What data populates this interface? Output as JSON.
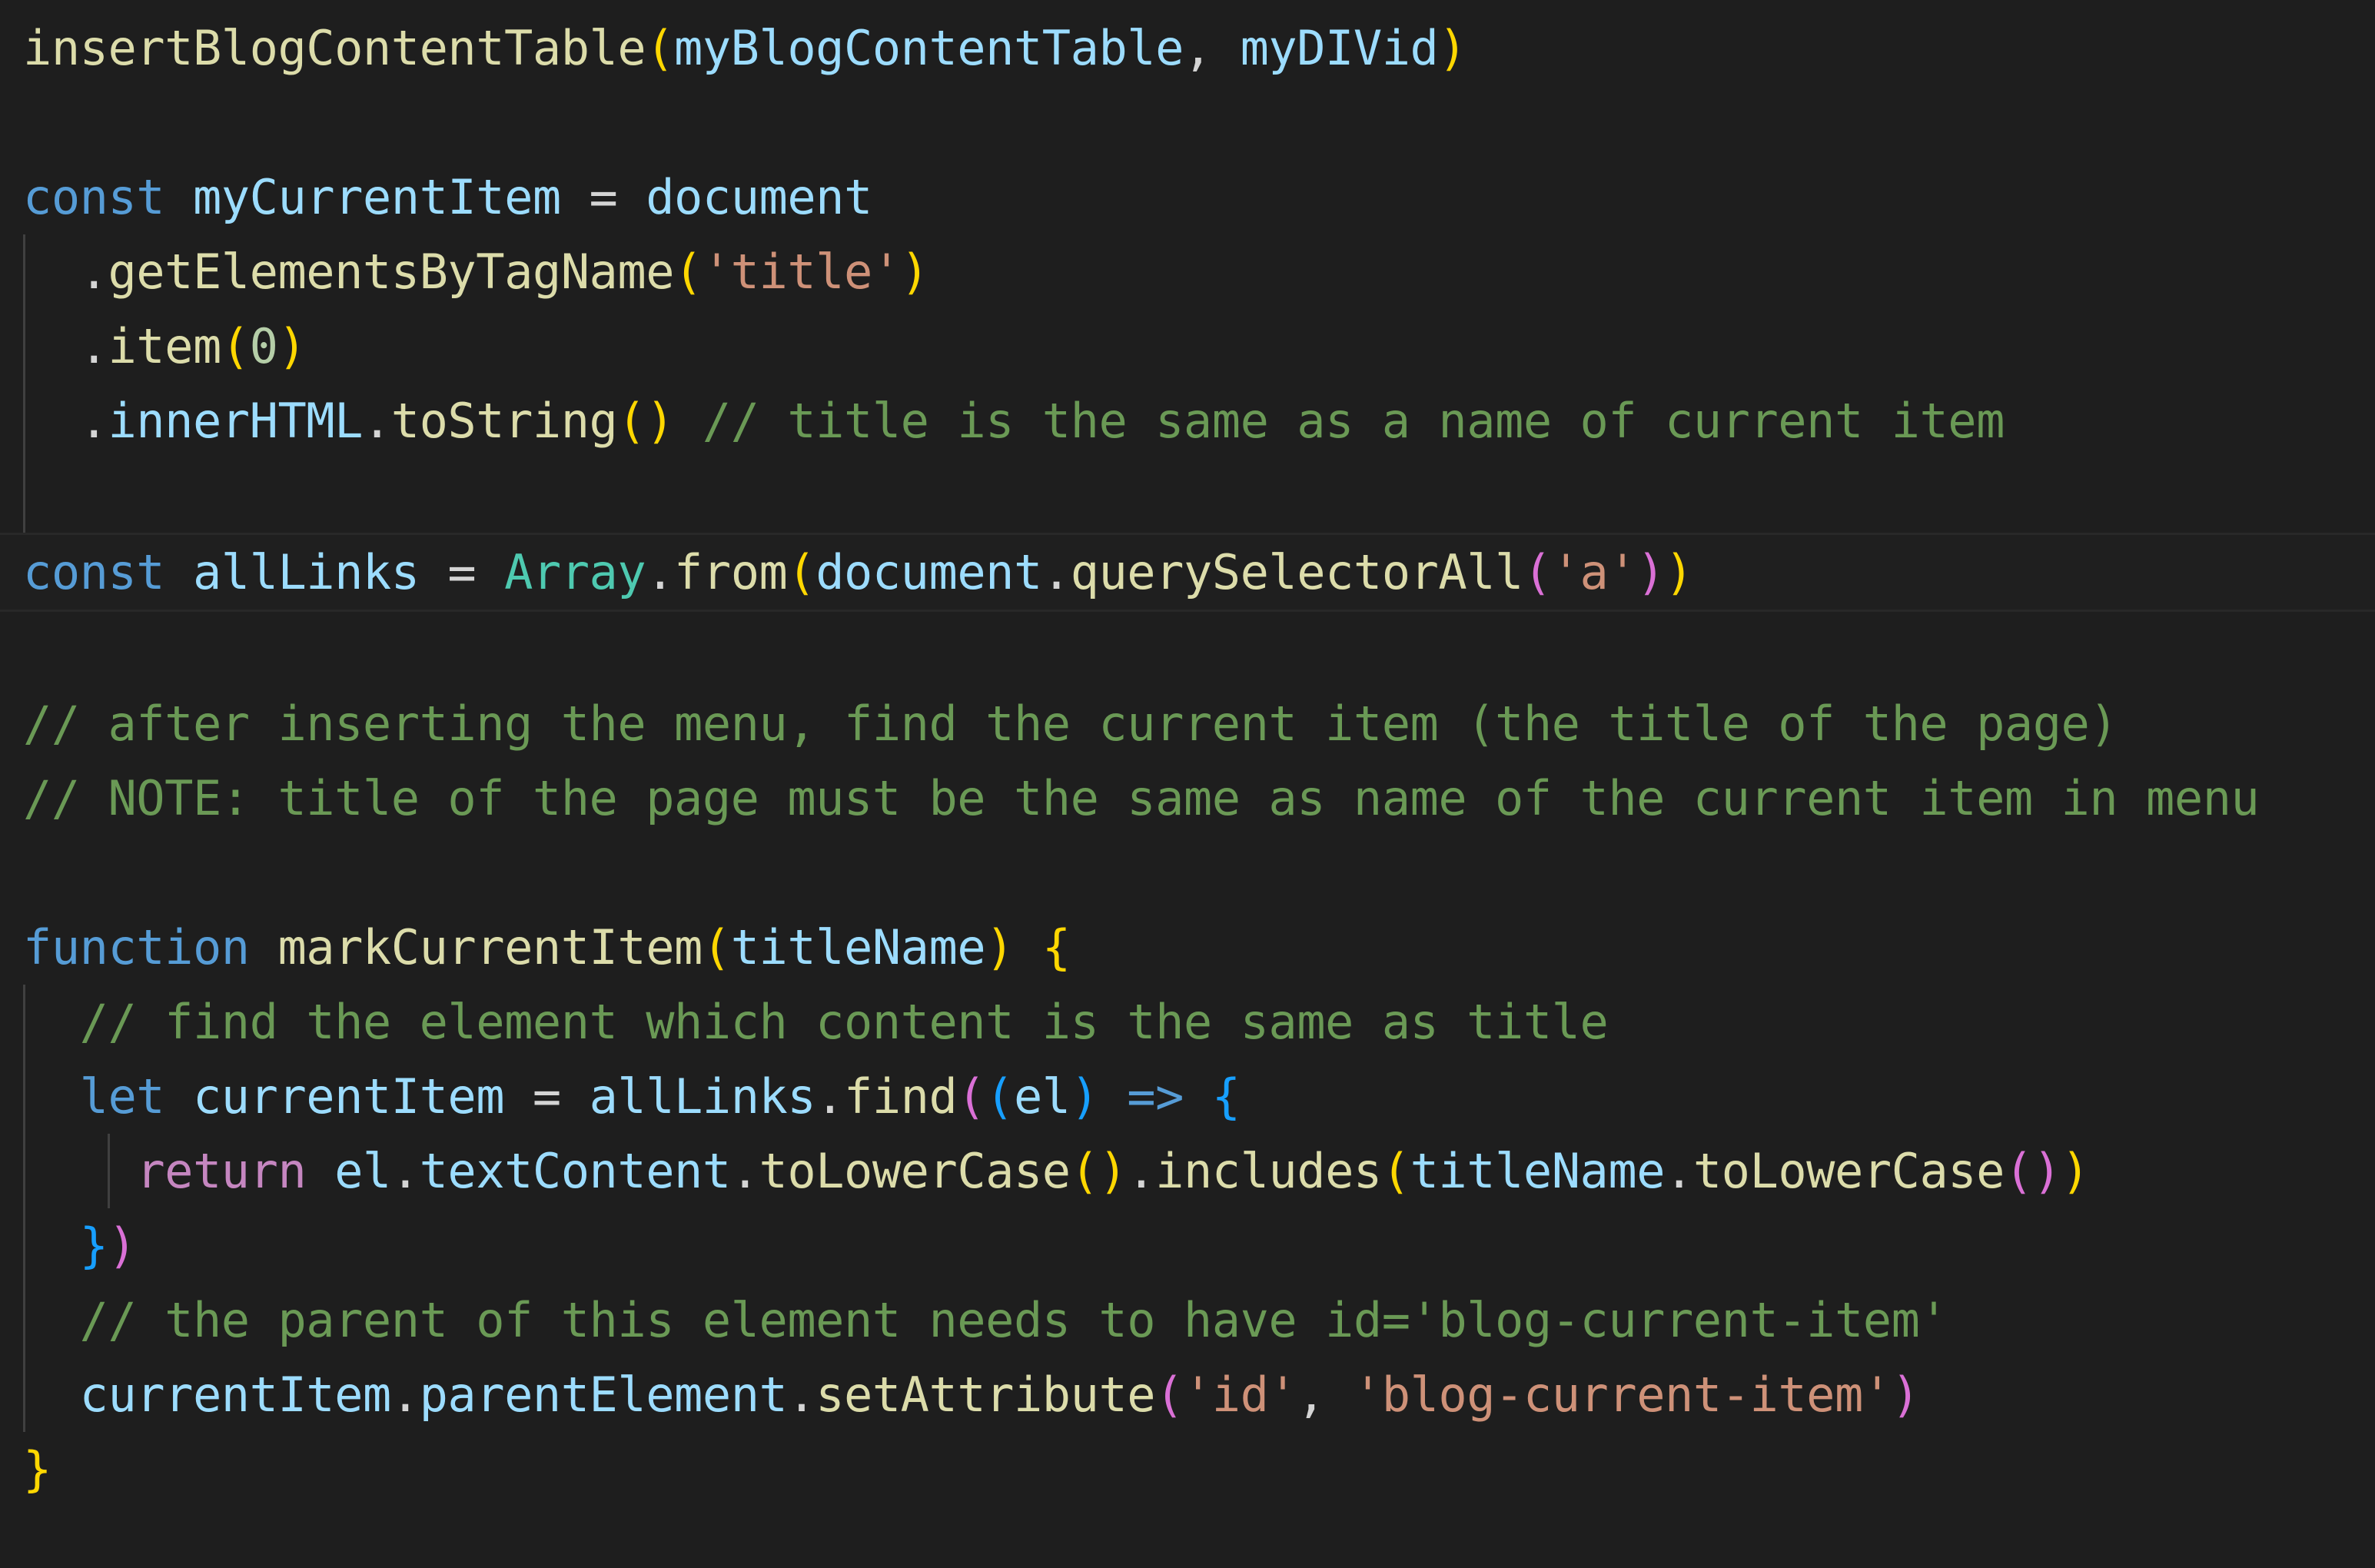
{
  "editor": {
    "theme_name": "dark-plus",
    "language": "javascript",
    "background_color": "#1e1e1e",
    "current_line_background": "#1f1f1f",
    "current_line_border_color": "#282828",
    "indent_guide_color": "#404040",
    "colors": {
      "function": "#dcdcaa",
      "variable": "#9cdcfe",
      "keyword": "#569cd6",
      "control_keyword": "#c586c0",
      "string": "#ce9178",
      "number": "#b5cea8",
      "comment": "#6a9955",
      "class": "#4ec9b0",
      "plain": "#d4d4d4",
      "bracket_level_1": "#ffd700",
      "bracket_level_2": "#da70d6",
      "bracket_level_3": "#179fff"
    },
    "lines": [
      {
        "index": 1,
        "current": false,
        "indent_guides": 0,
        "text": "insertBlogContentTable(myBlogContentTable, myDIVid)",
        "tokens": [
          {
            "t": "insertBlogContentTable",
            "c": "t-fn"
          },
          {
            "t": "(",
            "c": "t-b1"
          },
          {
            "t": "myBlogContentTable",
            "c": "t-var"
          },
          {
            "t": ", ",
            "c": "t-plain"
          },
          {
            "t": "myDIVid",
            "c": "t-var"
          },
          {
            "t": ")",
            "c": "t-b1"
          }
        ]
      },
      {
        "index": 2,
        "current": false,
        "indent_guides": 0,
        "text": "",
        "tokens": []
      },
      {
        "index": 3,
        "current": false,
        "indent_guides": 0,
        "text": "const myCurrentItem = document",
        "tokens": [
          {
            "t": "const",
            "c": "t-kw"
          },
          {
            "t": " ",
            "c": "t-plain"
          },
          {
            "t": "myCurrentItem",
            "c": "t-var"
          },
          {
            "t": " = ",
            "c": "t-op"
          },
          {
            "t": "document",
            "c": "t-var"
          }
        ]
      },
      {
        "index": 4,
        "current": false,
        "indent_guides": 1,
        "text": "  .getElementsByTagName('title')",
        "tokens": [
          {
            "t": "  .",
            "c": "t-plain"
          },
          {
            "t": "getElementsByTagName",
            "c": "t-fn"
          },
          {
            "t": "(",
            "c": "t-b1"
          },
          {
            "t": "'title'",
            "c": "t-str"
          },
          {
            "t": ")",
            "c": "t-b1"
          }
        ]
      },
      {
        "index": 5,
        "current": false,
        "indent_guides": 1,
        "text": "  .item(0)",
        "tokens": [
          {
            "t": "  .",
            "c": "t-plain"
          },
          {
            "t": "item",
            "c": "t-fn"
          },
          {
            "t": "(",
            "c": "t-b1"
          },
          {
            "t": "0",
            "c": "t-num"
          },
          {
            "t": ")",
            "c": "t-b1"
          }
        ]
      },
      {
        "index": 6,
        "current": false,
        "indent_guides": 1,
        "text": "  .innerHTML.toString() // title is the same as a name of current item",
        "tokens": [
          {
            "t": "  .",
            "c": "t-plain"
          },
          {
            "t": "innerHTML",
            "c": "t-var"
          },
          {
            "t": ".",
            "c": "t-plain"
          },
          {
            "t": "toString",
            "c": "t-fn"
          },
          {
            "t": "(",
            "c": "t-b1"
          },
          {
            "t": ")",
            "c": "t-b1"
          },
          {
            "t": " ",
            "c": "t-plain"
          },
          {
            "t": "// title is the same as a name of current item",
            "c": "t-comment"
          }
        ]
      },
      {
        "index": 7,
        "current": false,
        "indent_guides": 1,
        "text": "",
        "tokens": []
      },
      {
        "index": 8,
        "current": true,
        "indent_guides": 0,
        "text": "const allLinks = Array.from(document.querySelectorAll('a'))",
        "tokens": [
          {
            "t": "const",
            "c": "t-kw"
          },
          {
            "t": " ",
            "c": "t-plain"
          },
          {
            "t": "allLinks",
            "c": "t-var"
          },
          {
            "t": " = ",
            "c": "t-op"
          },
          {
            "t": "Array",
            "c": "t-class"
          },
          {
            "t": ".",
            "c": "t-plain"
          },
          {
            "t": "from",
            "c": "t-fn"
          },
          {
            "t": "(",
            "c": "t-b1"
          },
          {
            "t": "document",
            "c": "t-var"
          },
          {
            "t": ".",
            "c": "t-plain"
          },
          {
            "t": "querySelectorAll",
            "c": "t-fn"
          },
          {
            "t": "(",
            "c": "t-b2"
          },
          {
            "t": "'a'",
            "c": "t-str"
          },
          {
            "t": ")",
            "c": "t-b2"
          },
          {
            "t": ")",
            "c": "t-b1"
          }
        ]
      },
      {
        "index": 9,
        "current": false,
        "indent_guides": 0,
        "text": "",
        "tokens": []
      },
      {
        "index": 10,
        "current": false,
        "indent_guides": 0,
        "text": "// after inserting the menu, find the current item (the title of the page)",
        "tokens": [
          {
            "t": "// after inserting the menu, find the current item (the title of the page)",
            "c": "t-comment"
          }
        ]
      },
      {
        "index": 11,
        "current": false,
        "indent_guides": 0,
        "text": "// NOTE: title of the page must be the same as name of the current item in menu",
        "tokens": [
          {
            "t": "// NOTE: title of the page must be the same as name of the current item in menu",
            "c": "t-comment"
          }
        ]
      },
      {
        "index": 12,
        "current": false,
        "indent_guides": 0,
        "text": "",
        "tokens": []
      },
      {
        "index": 13,
        "current": false,
        "indent_guides": 0,
        "text": "function markCurrentItem(titleName) {",
        "tokens": [
          {
            "t": "function",
            "c": "t-kw"
          },
          {
            "t": " ",
            "c": "t-plain"
          },
          {
            "t": "markCurrentItem",
            "c": "t-fn"
          },
          {
            "t": "(",
            "c": "t-b1"
          },
          {
            "t": "titleName",
            "c": "t-var"
          },
          {
            "t": ")",
            "c": "t-b1"
          },
          {
            "t": " ",
            "c": "t-plain"
          },
          {
            "t": "{",
            "c": "t-b1"
          }
        ]
      },
      {
        "index": 14,
        "current": false,
        "indent_guides": 1,
        "text": "  // find the element which content is the same as title",
        "tokens": [
          {
            "t": "  ",
            "c": "t-plain"
          },
          {
            "t": "// find the element which content is the same as title",
            "c": "t-comment"
          }
        ]
      },
      {
        "index": 15,
        "current": false,
        "indent_guides": 1,
        "text": "  let currentItem = allLinks.find((el) => {",
        "tokens": [
          {
            "t": "  ",
            "c": "t-plain"
          },
          {
            "t": "let",
            "c": "t-kw"
          },
          {
            "t": " ",
            "c": "t-plain"
          },
          {
            "t": "currentItem",
            "c": "t-var"
          },
          {
            "t": " = ",
            "c": "t-op"
          },
          {
            "t": "allLinks",
            "c": "t-var"
          },
          {
            "t": ".",
            "c": "t-plain"
          },
          {
            "t": "find",
            "c": "t-fn"
          },
          {
            "t": "(",
            "c": "t-b2"
          },
          {
            "t": "(",
            "c": "t-b3"
          },
          {
            "t": "el",
            "c": "t-var"
          },
          {
            "t": ")",
            "c": "t-b3"
          },
          {
            "t": " ",
            "c": "t-plain"
          },
          {
            "t": "=>",
            "c": "t-kw"
          },
          {
            "t": " ",
            "c": "t-plain"
          },
          {
            "t": "{",
            "c": "t-b3"
          }
        ]
      },
      {
        "index": 16,
        "current": false,
        "indent_guides": 2,
        "text": "    return el.textContent.toLowerCase().includes(titleName.toLowerCase())",
        "tokens": [
          {
            "t": "    ",
            "c": "t-plain"
          },
          {
            "t": "return",
            "c": "t-ctrl"
          },
          {
            "t": " ",
            "c": "t-plain"
          },
          {
            "t": "el",
            "c": "t-var"
          },
          {
            "t": ".",
            "c": "t-plain"
          },
          {
            "t": "textContent",
            "c": "t-var"
          },
          {
            "t": ".",
            "c": "t-plain"
          },
          {
            "t": "toLowerCase",
            "c": "t-fn"
          },
          {
            "t": "(",
            "c": "t-b1"
          },
          {
            "t": ")",
            "c": "t-b1"
          },
          {
            "t": ".",
            "c": "t-plain"
          },
          {
            "t": "includes",
            "c": "t-fn"
          },
          {
            "t": "(",
            "c": "t-b1"
          },
          {
            "t": "titleName",
            "c": "t-var"
          },
          {
            "t": ".",
            "c": "t-plain"
          },
          {
            "t": "toLowerCase",
            "c": "t-fn"
          },
          {
            "t": "(",
            "c": "t-b2"
          },
          {
            "t": ")",
            "c": "t-b2"
          },
          {
            "t": ")",
            "c": "t-b1"
          }
        ]
      },
      {
        "index": 17,
        "current": false,
        "indent_guides": 1,
        "text": "  })",
        "tokens": [
          {
            "t": "  ",
            "c": "t-plain"
          },
          {
            "t": "}",
            "c": "t-b3"
          },
          {
            "t": ")",
            "c": "t-b2"
          }
        ]
      },
      {
        "index": 18,
        "current": false,
        "indent_guides": 1,
        "text": "  // the parent of this element needs to have id='blog-current-item'",
        "tokens": [
          {
            "t": "  ",
            "c": "t-plain"
          },
          {
            "t": "// the parent of this element needs to have id='blog-current-item'",
            "c": "t-comment"
          }
        ]
      },
      {
        "index": 19,
        "current": false,
        "indent_guides": 1,
        "text": "  currentItem.parentElement.setAttribute('id', 'blog-current-item')",
        "tokens": [
          {
            "t": "  ",
            "c": "t-plain"
          },
          {
            "t": "currentItem",
            "c": "t-var"
          },
          {
            "t": ".",
            "c": "t-plain"
          },
          {
            "t": "parentElement",
            "c": "t-var"
          },
          {
            "t": ".",
            "c": "t-plain"
          },
          {
            "t": "setAttribute",
            "c": "t-fn"
          },
          {
            "t": "(",
            "c": "t-b2"
          },
          {
            "t": "'id'",
            "c": "t-str"
          },
          {
            "t": ", ",
            "c": "t-plain"
          },
          {
            "t": "'blog-current-item'",
            "c": "t-str"
          },
          {
            "t": ")",
            "c": "t-b2"
          }
        ]
      },
      {
        "index": 20,
        "current": false,
        "indent_guides": 0,
        "text": "}",
        "tokens": [
          {
            "t": "}",
            "c": "t-b1"
          }
        ]
      }
    ]
  }
}
